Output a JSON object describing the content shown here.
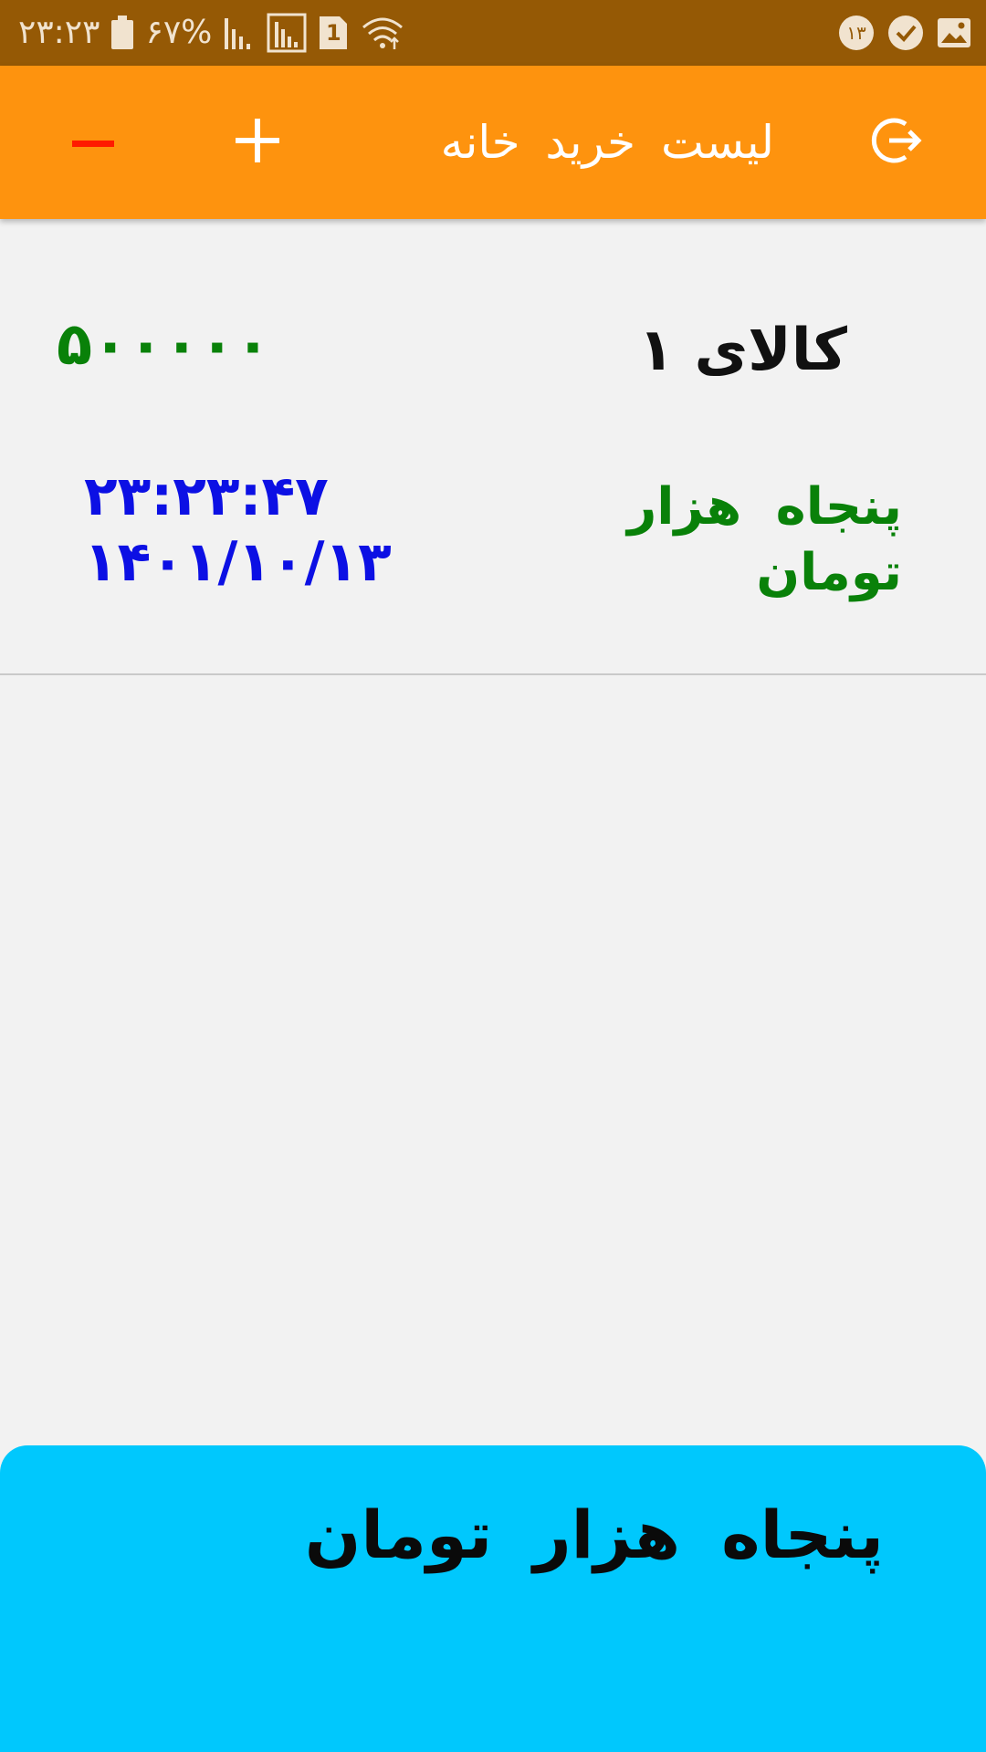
{
  "status_bar": {
    "time": "۲۳:۲۳",
    "battery": "۶۷%",
    "sim_badge": "1",
    "notification_badge": "۱۳",
    "icons": [
      "battery-icon",
      "signal-icon",
      "signal-box-icon",
      "sim-icon",
      "wifi-icon",
      "notification-count-icon",
      "check-shield-icon",
      "image-icon"
    ]
  },
  "toolbar": {
    "title": "لیست خرید خانه",
    "background_color": "#fe930e",
    "minus_icon": "minus-icon",
    "plus_icon": "plus-icon",
    "logout_icon": "logout-icon",
    "minus_color": "#ff1a00"
  },
  "items": [
    {
      "name": "کالای ۱",
      "price_number": "۵۰۰۰۰۰",
      "price_words": "پنجاه هزار تومان",
      "time": "۲۳:۲۳:۴۷",
      "date": "۱۴۰۱/۱۰/۱۳"
    }
  ],
  "colors": {
    "price": "#098109",
    "datetime": "#0c10e4",
    "total_panel": "#00c8fd"
  },
  "total": {
    "label": "پنجاه هزار تومان"
  }
}
